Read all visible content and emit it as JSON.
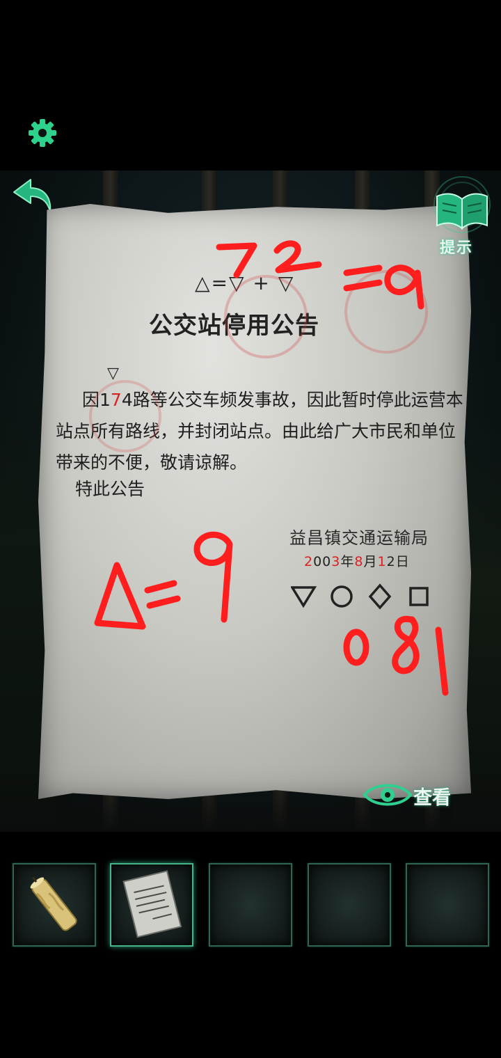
{
  "hud": {
    "settings_icon": "gear-icon",
    "back_icon": "back-arrow-icon",
    "hint_icon": "open-book-icon",
    "hint_label": "提示",
    "view_icon": "eye-icon",
    "view_label": "查看",
    "accent_color": "#2fd08f"
  },
  "notice": {
    "formula": "△=▽ + ▽",
    "title": "公交站停用公告",
    "marker": "▽",
    "para_pre": "因1",
    "para_red": "7",
    "para_post": "4路等公交车频发事故，因此暂时停此运营本站点所有路线，并封闭站点。由此给广大市民和单位带来的不便，敬请谅解。",
    "closing": "特此公告",
    "org": "益昌镇交通运输局",
    "date_parts": [
      "2",
      "00",
      "3",
      "年",
      "8",
      "月",
      "1",
      "2",
      "日"
    ],
    "shapes": [
      "triangle-down-shape",
      "circle-shape",
      "diamond-shape",
      "square-shape"
    ],
    "red_text_color": "#d92323"
  },
  "annotations": {
    "top_equation": "7 2 =9",
    "triangle_equation": "△=9",
    "code": "081",
    "ink_color": "#ff2020"
  },
  "inventory": {
    "slots": [
      {
        "item": "candle-item",
        "selected": false
      },
      {
        "item": "notice-paper-item",
        "selected": true
      },
      {
        "item": "",
        "selected": false
      },
      {
        "item": "",
        "selected": false
      },
      {
        "item": "",
        "selected": false
      }
    ]
  }
}
